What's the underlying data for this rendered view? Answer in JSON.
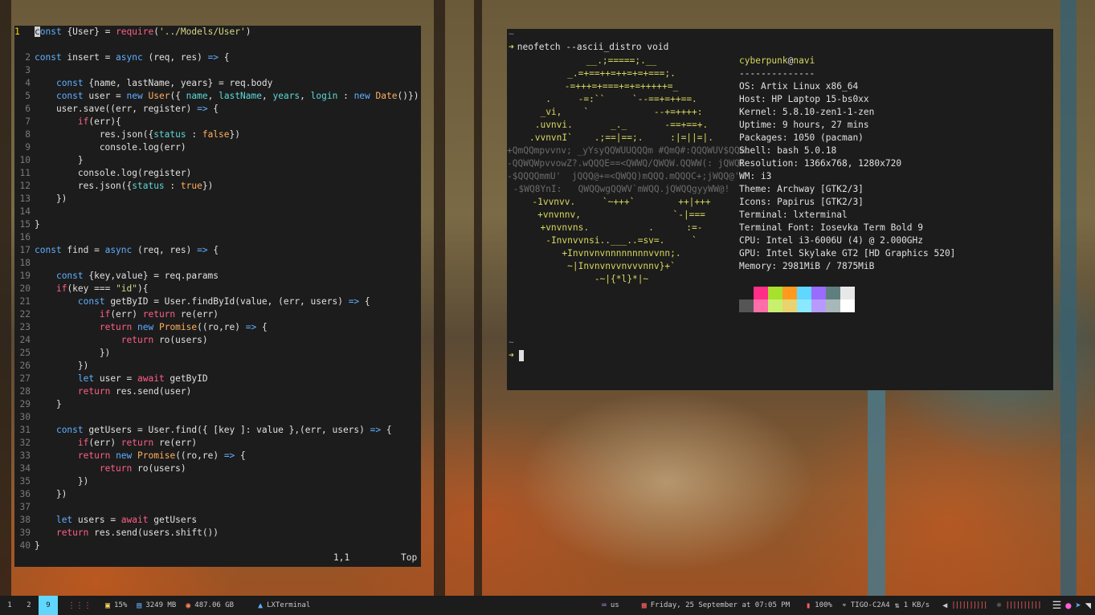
{
  "vim": {
    "lines": [
      {
        "n": "1",
        "html": "<span class='cursor'>c</span><span class='k'>onst</span> {User} = <span class='p'>require</span>(<span class='s'>'../Models/User'</span>)"
      },
      {
        "n": "",
        "html": ""
      },
      {
        "n": "2",
        "html": "<span class='k'>const</span> insert = <span class='k'>async</span> (req, res) <span class='k'>=></span> {"
      },
      {
        "n": "3",
        "html": ""
      },
      {
        "n": "4",
        "html": "    <span class='k'>const</span> {name, lastName, years} = req.body"
      },
      {
        "n": "5",
        "html": "    <span class='k'>const</span> user = <span class='k'>new</span> <span class='o'>User</span>({ <span class='b'>name</span>, <span class='b'>lastName</span>, <span class='b'>years</span>, <span class='b'>login</span> : <span class='k'>new</span> <span class='o'>Date</span>()})"
      },
      {
        "n": "6",
        "html": "    user.save((err, register) <span class='k'>=></span> {"
      },
      {
        "n": "7",
        "html": "        <span class='p'>if</span>(err){"
      },
      {
        "n": "8",
        "html": "            res.json({<span class='b'>status</span> : <span class='o'>false</span>})"
      },
      {
        "n": "9",
        "html": "            console.log(err)"
      },
      {
        "n": "10",
        "html": "        }"
      },
      {
        "n": "11",
        "html": "        console.log(register)"
      },
      {
        "n": "12",
        "html": "        res.json({<span class='b'>status</span> : <span class='o'>true</span>})"
      },
      {
        "n": "13",
        "html": "    })"
      },
      {
        "n": "14",
        "html": ""
      },
      {
        "n": "15",
        "html": "}"
      },
      {
        "n": "16",
        "html": ""
      },
      {
        "n": "17",
        "html": "<span class='k'>const</span> find = <span class='k'>async</span> (req, res) <span class='k'>=></span> {"
      },
      {
        "n": "18",
        "html": ""
      },
      {
        "n": "19",
        "html": "    <span class='k'>const</span> {key,value} = req.params"
      },
      {
        "n": "20",
        "html": "    <span class='p'>if</span>(key === <span class='s'>\"id\"</span>){"
      },
      {
        "n": "21",
        "html": "        <span class='k'>const</span> getByID = User.findById(value, (err, users) <span class='k'>=></span> {"
      },
      {
        "n": "22",
        "html": "            <span class='p'>if</span>(err) <span class='p'>return</span> re(err)"
      },
      {
        "n": "23",
        "html": "            <span class='p'>return</span> <span class='k'>new</span> <span class='o'>Promise</span>((ro,re) <span class='k'>=></span> {"
      },
      {
        "n": "24",
        "html": "                <span class='p'>return</span> ro(users)"
      },
      {
        "n": "25",
        "html": "            })"
      },
      {
        "n": "26",
        "html": "        })"
      },
      {
        "n": "27",
        "html": "        <span class='k'>let</span> user = <span class='p'>await</span> getByID"
      },
      {
        "n": "28",
        "html": "        <span class='p'>return</span> res.send(user)"
      },
      {
        "n": "29",
        "html": "    }"
      },
      {
        "n": "30",
        "html": ""
      },
      {
        "n": "31",
        "html": "    <span class='k'>const</span> getUsers = User.find({ [key ]: value },(err, users) <span class='k'>=></span> {"
      },
      {
        "n": "32",
        "html": "        <span class='p'>if</span>(err) <span class='p'>return</span> re(err)"
      },
      {
        "n": "33",
        "html": "        <span class='p'>return</span> <span class='k'>new</span> <span class='o'>Promise</span>((ro,re) <span class='k'>=></span> {"
      },
      {
        "n": "34",
        "html": "            <span class='p'>return</span> ro(users)"
      },
      {
        "n": "35",
        "html": "        })"
      },
      {
        "n": "36",
        "html": "    })"
      },
      {
        "n": "37",
        "html": ""
      },
      {
        "n": "38",
        "html": "    <span class='k'>let</span> users = <span class='p'>await</span> getUsers"
      },
      {
        "n": "39",
        "html": "    <span class='p'>return</span> res.send(users.shift())"
      },
      {
        "n": "40",
        "html": "}"
      }
    ],
    "status_pos": "1,1",
    "status_scroll": "Top"
  },
  "terminal": {
    "tilde": "~",
    "prompt_arrow": "➜",
    "command": "neofetch --ascii_distro void",
    "ascii": [
      {
        "t": "__.;=====;.__",
        "dim": false
      },
      {
        "t": "_.=+==++=++=+=+===;.",
        "dim": false
      },
      {
        "t": "-=+++=+===+=+=+++++=_",
        "dim": false
      },
      {
        "t": ".     -=:``     `--==+=++==.",
        "dim": false
      },
      {
        "t": "_vi,    `            --+=++++:",
        "dim": false
      },
      {
        "t": ".uvnvi.       _._       -==+==+.",
        "dim": false
      },
      {
        "t": ".vvnvnI`    .;==|==;.     :|=||=|.",
        "dim": false
      },
      {
        "t": "+QmQQmpvvnv; _yYsyQQWUUQQQm #QmQ#:QQQWUV$QQm.",
        "dim": true
      },
      {
        "t": "-QQWQWpvvowZ?.wQQQE==<QWWQ/QWQW.QQWW(: jQWQE",
        "dim": true
      },
      {
        "t": "-$QQQQmmU'  jQQQ@+=<QWQQ)mQQQ.mQQQC+;jWQQ@'",
        "dim": true
      },
      {
        "t": "-$WQ8YnI:   QWQQwgQQWV`mWQQ.jQWQQgyyWW@!",
        "dim": true
      },
      {
        "t": "-1vvnvv.     `~+++`        ++|+++",
        "dim": false
      },
      {
        "t": "+vnvnnv,                 `-|===",
        "dim": false
      },
      {
        "t": "+vnvnvns.           .      :=-",
        "dim": false
      },
      {
        "t": "-Invnvvnsi..___..=sv=.     `",
        "dim": false
      },
      {
        "t": "+Invnvnvnnnnnnnnvvnn;.",
        "dim": false
      },
      {
        "t": "~|Invnvnvvnvvvnnv}+`",
        "dim": false
      },
      {
        "t": "-~|{*l}*|~",
        "dim": false
      }
    ],
    "user": "cyberpunk",
    "at": "@",
    "host": "navi",
    "divider": "--------------",
    "info": [
      "OS: Artix Linux x86_64",
      "Host: HP Laptop 15-bs0xx",
      "Kernel: 5.8.10-zen1-1-zen",
      "Uptime: 9 hours, 27 mins",
      "Packages: 1050 (pacman)",
      "Shell: bash 5.0.18",
      "Resolution: 1366x768, 1280x720",
      "WM: i3",
      "Theme: Archway [GTK2/3]",
      "Icons: Papirus [GTK2/3]",
      "Terminal: lxterminal",
      "Terminal Font: Iosevka Term Bold 9",
      "CPU: Intel i3-6006U (4) @ 2.000GHz",
      "GPU: Intel Skylake GT2 [HD Graphics 520]",
      "Memory: 2981MiB / 7875MiB"
    ],
    "palette_top": [
      "#1c1c1c",
      "#ff2e88",
      "#a8e02e",
      "#ff9a1e",
      "#5fd7ff",
      "#9a6bff",
      "#5f7f7f",
      "#e8e8e8"
    ],
    "palette_bottom": [
      "#555555",
      "#ff6ea8",
      "#c8f06e",
      "#e8d36e",
      "#8ae8ff",
      "#b89aff",
      "#a8b8b8",
      "#ffffff"
    ],
    "second_tilde": "~"
  },
  "bar": {
    "workspaces": [
      "1",
      "2",
      "9"
    ],
    "active_workspace": "9",
    "cpu_icon": "chip-icon",
    "cpu": "15%",
    "ram": "3249 MB",
    "disk": "487.06 GB",
    "window_title": "LXTerminal",
    "keyboard": "us",
    "date": "Friday, 25 September at 07:05 PM",
    "battery": "100%",
    "wifi": "TIGO-C2A4",
    "net": "1 KB/s",
    "accent": "#5fd7ff"
  }
}
